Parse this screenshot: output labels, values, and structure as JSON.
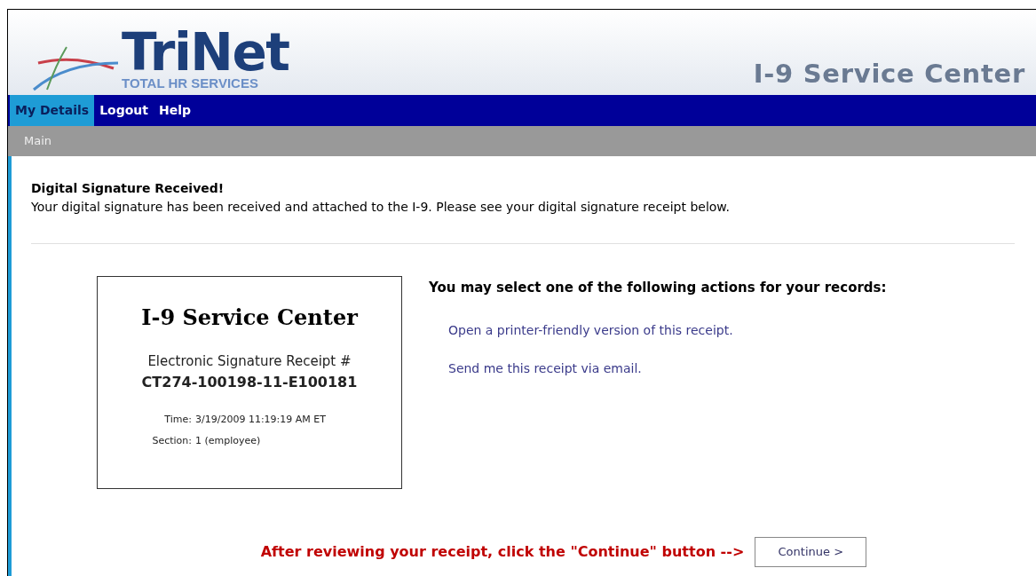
{
  "header": {
    "logo": {
      "name": "TriNet",
      "tagline": "TOTAL HR SERVICES"
    },
    "title": "I-9 Service Center"
  },
  "nav": [
    {
      "label": "My Details",
      "selected": true
    },
    {
      "label": "Logout",
      "selected": false
    },
    {
      "label": "Help",
      "selected": false
    }
  ],
  "breadcrumb": "Main",
  "message": {
    "heading": "Digital Signature Received!",
    "body": "Your digital signature has been received and attached to the I-9. Please see your digital signature receipt below."
  },
  "receipt": {
    "title": "I-9 Service Center",
    "label": "Electronic Signature Receipt #",
    "number": "CT274-100198-11-E100181",
    "fields": [
      {
        "label": "Time:",
        "value": "3/19/2009 11:19:19 AM ET"
      },
      {
        "label": "Section:",
        "value": "1 (employee)"
      }
    ]
  },
  "actions": {
    "heading": "You may select one of the following actions for your records:",
    "links": [
      "Open a printer-friendly version of this receipt.",
      "Send me this receipt via email."
    ]
  },
  "footer": {
    "prompt": "After reviewing your receipt, click the \"Continue\" button -->",
    "button": "Continue >"
  }
}
